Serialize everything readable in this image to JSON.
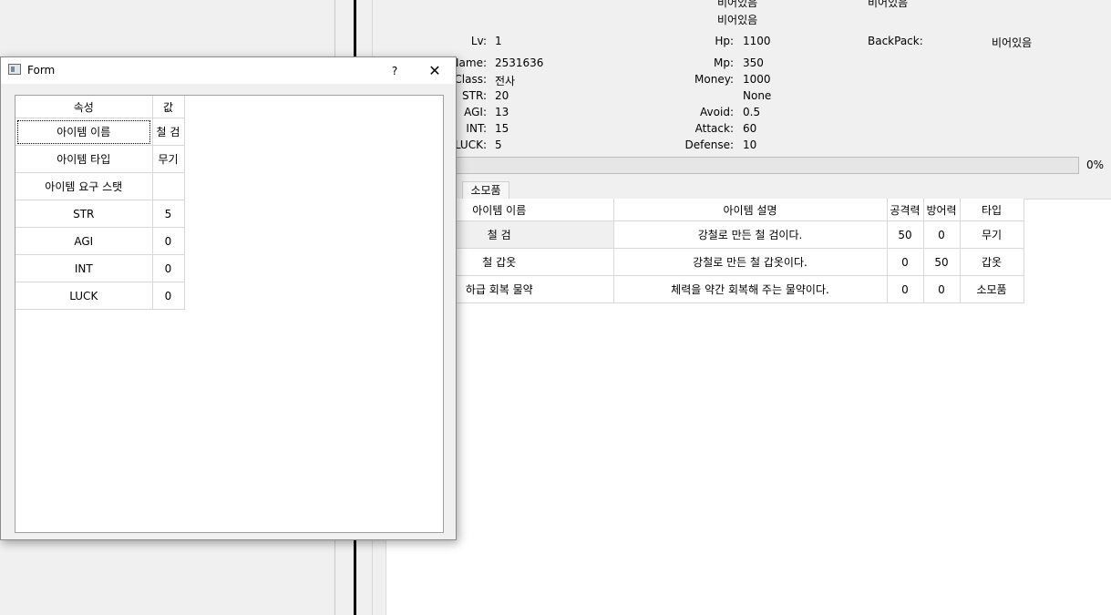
{
  "top_partial": {
    "col1": [
      "비어있음",
      "비어있음"
    ],
    "col2": "비어있음"
  },
  "stats": {
    "lv_label": "Lv:",
    "lv": "1",
    "hp_label": "Hp:",
    "hp": "1100",
    "backpack_label": "BackPack:",
    "backpack": "비어있음",
    "name_label": "Name:",
    "name": "2531636",
    "mp_label": "Mp:",
    "mp": "350",
    "class_label": "Class:",
    "class": "전사",
    "money_label": "Money:",
    "money": "1000",
    "str_label": "STR:",
    "str": "20",
    "extra": "None",
    "agi_label": "AGI:",
    "agi": "13",
    "avoid_label": "Avoid:",
    "avoid": "0.5",
    "int_label": "INT:",
    "int": "15",
    "attack_label": "Attack:",
    "attack": "60",
    "luck_label": "LUCK:",
    "luck": "5",
    "defense_label": "Defense:",
    "defense": "10"
  },
  "progress": {
    "value": 0,
    "text": "0%"
  },
  "tabs": {
    "consumables": "소모품"
  },
  "item_table": {
    "headers": [
      "아이템 이름",
      "아이템 설명",
      "공격력",
      "방어력",
      "타입"
    ],
    "rows": [
      [
        "철 검",
        "강철로 만든 철 검이다.",
        "50",
        "0",
        "무기"
      ],
      [
        "철 갑옷",
        "강철로 만든 철 갑옷이다.",
        "0",
        "50",
        "갑옷"
      ],
      [
        "하급 회복 물약",
        "체력을 약간 회복해 주는 물약이다.",
        "0",
        "0",
        "소모품"
      ]
    ]
  },
  "form": {
    "title": "Form",
    "help": "?",
    "close": "✕",
    "table": {
      "headers": [
        "속성",
        "값"
      ],
      "rows": [
        [
          "아이템 이름",
          "철 검"
        ],
        [
          "아이템 타입",
          "무기"
        ],
        [
          "아이템 요구 스탯",
          ""
        ],
        [
          "STR",
          "5"
        ],
        [
          "AGI",
          "0"
        ],
        [
          "INT",
          "0"
        ],
        [
          "LUCK",
          "0"
        ]
      ]
    }
  }
}
